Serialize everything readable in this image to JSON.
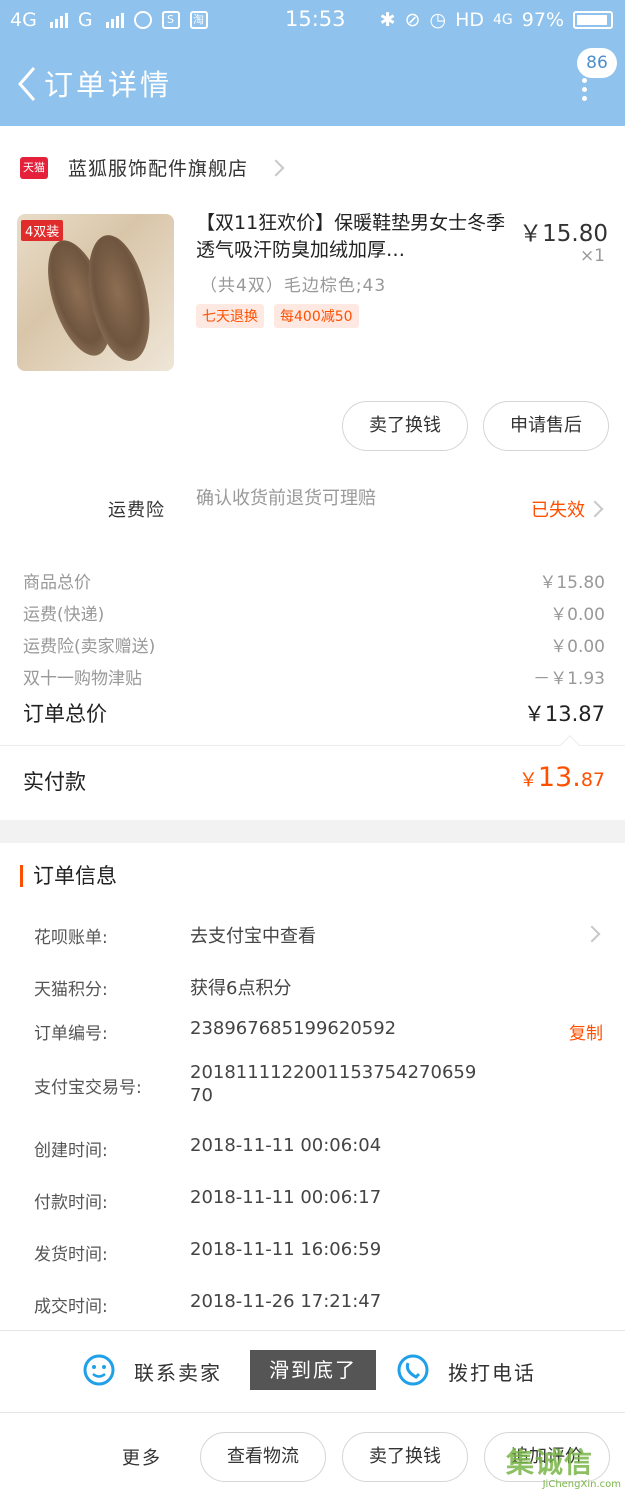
{
  "status_bar": {
    "network_1": "4G",
    "network_2": "G",
    "app_icon_2": "S",
    "app_icon_3": "淘",
    "time": "15:53",
    "right_network": "HD",
    "right_network_2": "4G",
    "battery": "97%"
  },
  "header": {
    "title": "订单详情",
    "badge": "86"
  },
  "shop": {
    "logo_text": "天猫",
    "name": "蓝狐服饰配件旗舰店"
  },
  "product": {
    "image_tag": "4双装",
    "title": "【双11狂欢价】保暖鞋垫男女士冬季透气吸汗防臭加绒加厚…",
    "price": "￥15.80",
    "quantity": "×1",
    "spec": "（共4双）毛边棕色;43",
    "tags": [
      "七天退换",
      "每400减50"
    ]
  },
  "actions": {
    "sell_button": "卖了换钱",
    "aftersale_button": "申请售后"
  },
  "insurance": {
    "label": "运费险",
    "description": "确认收货前退货可理赔",
    "status": "已失效"
  },
  "costs": [
    {
      "label": "商品总价",
      "value": "￥15.80"
    },
    {
      "label": "运费(快递)",
      "value": "￥0.00"
    },
    {
      "label": "运费险(卖家赠送)",
      "value": "￥0.00"
    },
    {
      "label": "双十一购物津贴",
      "value": "－￥1.93"
    }
  ],
  "order_total": {
    "label": "订单总价",
    "value": "￥13.87"
  },
  "paid": {
    "label": "实付款",
    "currency": "￥",
    "integer": "13.",
    "decimal": "87"
  },
  "order_info": {
    "title": "订单信息",
    "rows": [
      {
        "label": "花呗账单:",
        "value": "去支付宝中查看"
      },
      {
        "label": "天猫积分:",
        "value": "获得6点积分"
      },
      {
        "label": "订单编号:",
        "value": "238967685199620592",
        "action": "复制"
      },
      {
        "label": "支付宝交易号:",
        "value": "2018111122001153754270659",
        "value2": "70"
      },
      {
        "label": "创建时间:",
        "value": "2018-11-11 00:06:04"
      },
      {
        "label": "付款时间:",
        "value": "2018-11-11 00:06:17"
      },
      {
        "label": "发货时间:",
        "value": "2018-11-11 16:06:59"
      },
      {
        "label": "成交时间:",
        "value": "2018-11-26 17:21:47"
      }
    ]
  },
  "bottom_bar": {
    "contact": "联系卖家",
    "toast": "滑到底了",
    "call": "拨打电话",
    "more": "更多",
    "logistics": "查看物流",
    "sell": "卖了换钱",
    "review": "追加评价"
  },
  "watermark": {
    "main": "集诚信",
    "sub": "JiChengXin.com"
  }
}
